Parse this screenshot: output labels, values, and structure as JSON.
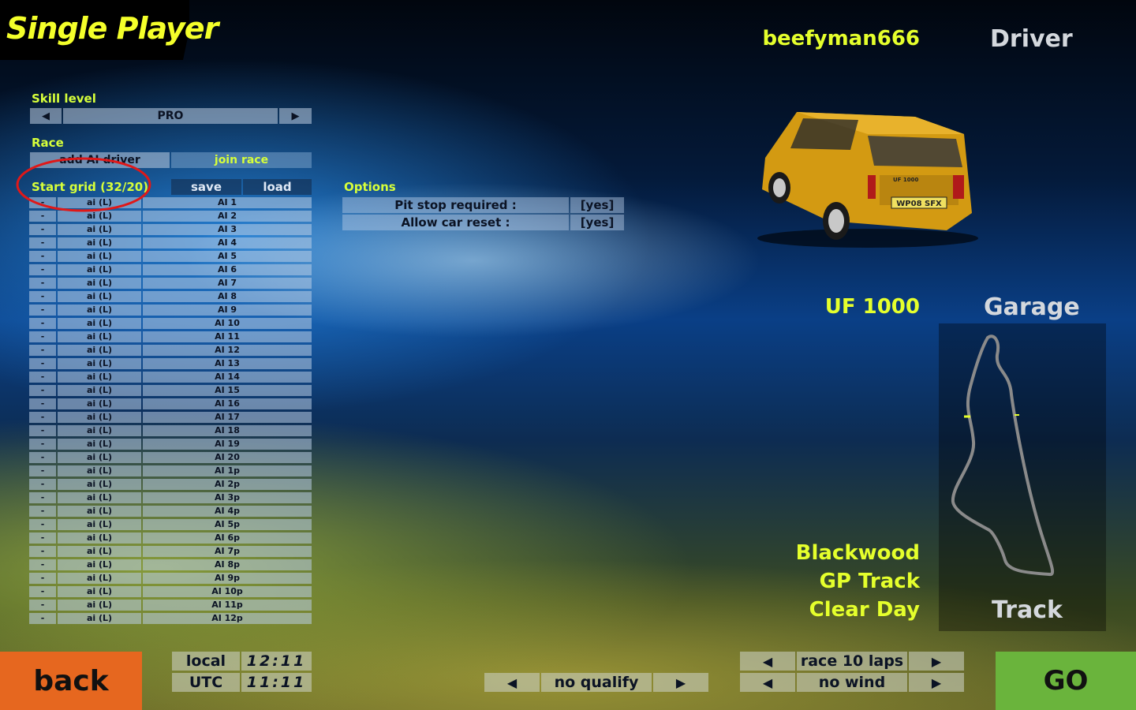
{
  "header": {
    "title": "Single Player"
  },
  "skill": {
    "label": "Skill level",
    "value": "PRO",
    "prev_icon": "left-arrow",
    "next_icon": "right-arrow"
  },
  "race": {
    "label": "Race",
    "add_ai_label": "add AI driver",
    "join_label": "join race"
  },
  "grid": {
    "label": "Start grid (32/20)",
    "save_label": "save",
    "load_label": "load",
    "rows": [
      {
        "dash": "-",
        "type": "ai (L)",
        "name": "AI 1"
      },
      {
        "dash": "-",
        "type": "ai (L)",
        "name": "AI 2"
      },
      {
        "dash": "-",
        "type": "ai (L)",
        "name": "AI 3"
      },
      {
        "dash": "-",
        "type": "ai (L)",
        "name": "AI 4"
      },
      {
        "dash": "-",
        "type": "ai (L)",
        "name": "AI 5"
      },
      {
        "dash": "-",
        "type": "ai (L)",
        "name": "AI 6"
      },
      {
        "dash": "-",
        "type": "ai (L)",
        "name": "AI 7"
      },
      {
        "dash": "-",
        "type": "ai (L)",
        "name": "AI 8"
      },
      {
        "dash": "-",
        "type": "ai (L)",
        "name": "AI 9"
      },
      {
        "dash": "-",
        "type": "ai (L)",
        "name": "AI 10"
      },
      {
        "dash": "-",
        "type": "ai (L)",
        "name": "AI 11"
      },
      {
        "dash": "-",
        "type": "ai (L)",
        "name": "AI 12"
      },
      {
        "dash": "-",
        "type": "ai (L)",
        "name": "AI 13"
      },
      {
        "dash": "-",
        "type": "ai (L)",
        "name": "AI 14"
      },
      {
        "dash": "-",
        "type": "ai (L)",
        "name": "AI 15"
      },
      {
        "dash": "-",
        "type": "ai (L)",
        "name": "AI 16"
      },
      {
        "dash": "-",
        "type": "ai (L)",
        "name": "AI 17"
      },
      {
        "dash": "-",
        "type": "ai (L)",
        "name": "AI 18"
      },
      {
        "dash": "-",
        "type": "ai (L)",
        "name": "AI 19"
      },
      {
        "dash": "-",
        "type": "ai (L)",
        "name": "AI 20"
      },
      {
        "dash": "-",
        "type": "ai (L)",
        "name": "AI 1p"
      },
      {
        "dash": "-",
        "type": "ai (L)",
        "name": "AI 2p"
      },
      {
        "dash": "-",
        "type": "ai (L)",
        "name": "AI 3p"
      },
      {
        "dash": "-",
        "type": "ai (L)",
        "name": "AI 4p"
      },
      {
        "dash": "-",
        "type": "ai (L)",
        "name": "AI 5p"
      },
      {
        "dash": "-",
        "type": "ai (L)",
        "name": "AI 6p"
      },
      {
        "dash": "-",
        "type": "ai (L)",
        "name": "AI 7p"
      },
      {
        "dash": "-",
        "type": "ai (L)",
        "name": "AI 8p"
      },
      {
        "dash": "-",
        "type": "ai (L)",
        "name": "AI 9p"
      },
      {
        "dash": "-",
        "type": "ai (L)",
        "name": "AI 10p"
      },
      {
        "dash": "-",
        "type": "ai (L)",
        "name": "AI 11p"
      },
      {
        "dash": "-",
        "type": "ai (L)",
        "name": "AI 12p"
      }
    ]
  },
  "options": {
    "label": "Options",
    "rows": [
      {
        "label": "Pit stop required :",
        "value": "[yes]"
      },
      {
        "label": "Allow car reset :",
        "value": "[yes]"
      }
    ]
  },
  "driver": {
    "name": "beefyman666",
    "label": "Driver"
  },
  "car": {
    "name": "UF 1000",
    "label": "Garage",
    "plate": "WP08 SFX",
    "badge": "UF 1000"
  },
  "track": {
    "label": "Track",
    "venue": "Blackwood",
    "layout": "GP Track",
    "weather": "Clear Day"
  },
  "bottom": {
    "back_label": "back",
    "go_label": "GO",
    "local_label": "local",
    "local_time": "12:11",
    "utc_label": "UTC",
    "utc_time": "11:11",
    "qualify_label": "no qualify",
    "race_label": "race 10 laps",
    "wind_label": "no wind"
  },
  "colors": {
    "accent_yellow": "#e5ff2c",
    "back_orange": "#e6671f",
    "go_green": "#6ab43c",
    "highlight_red": "#e01818"
  }
}
